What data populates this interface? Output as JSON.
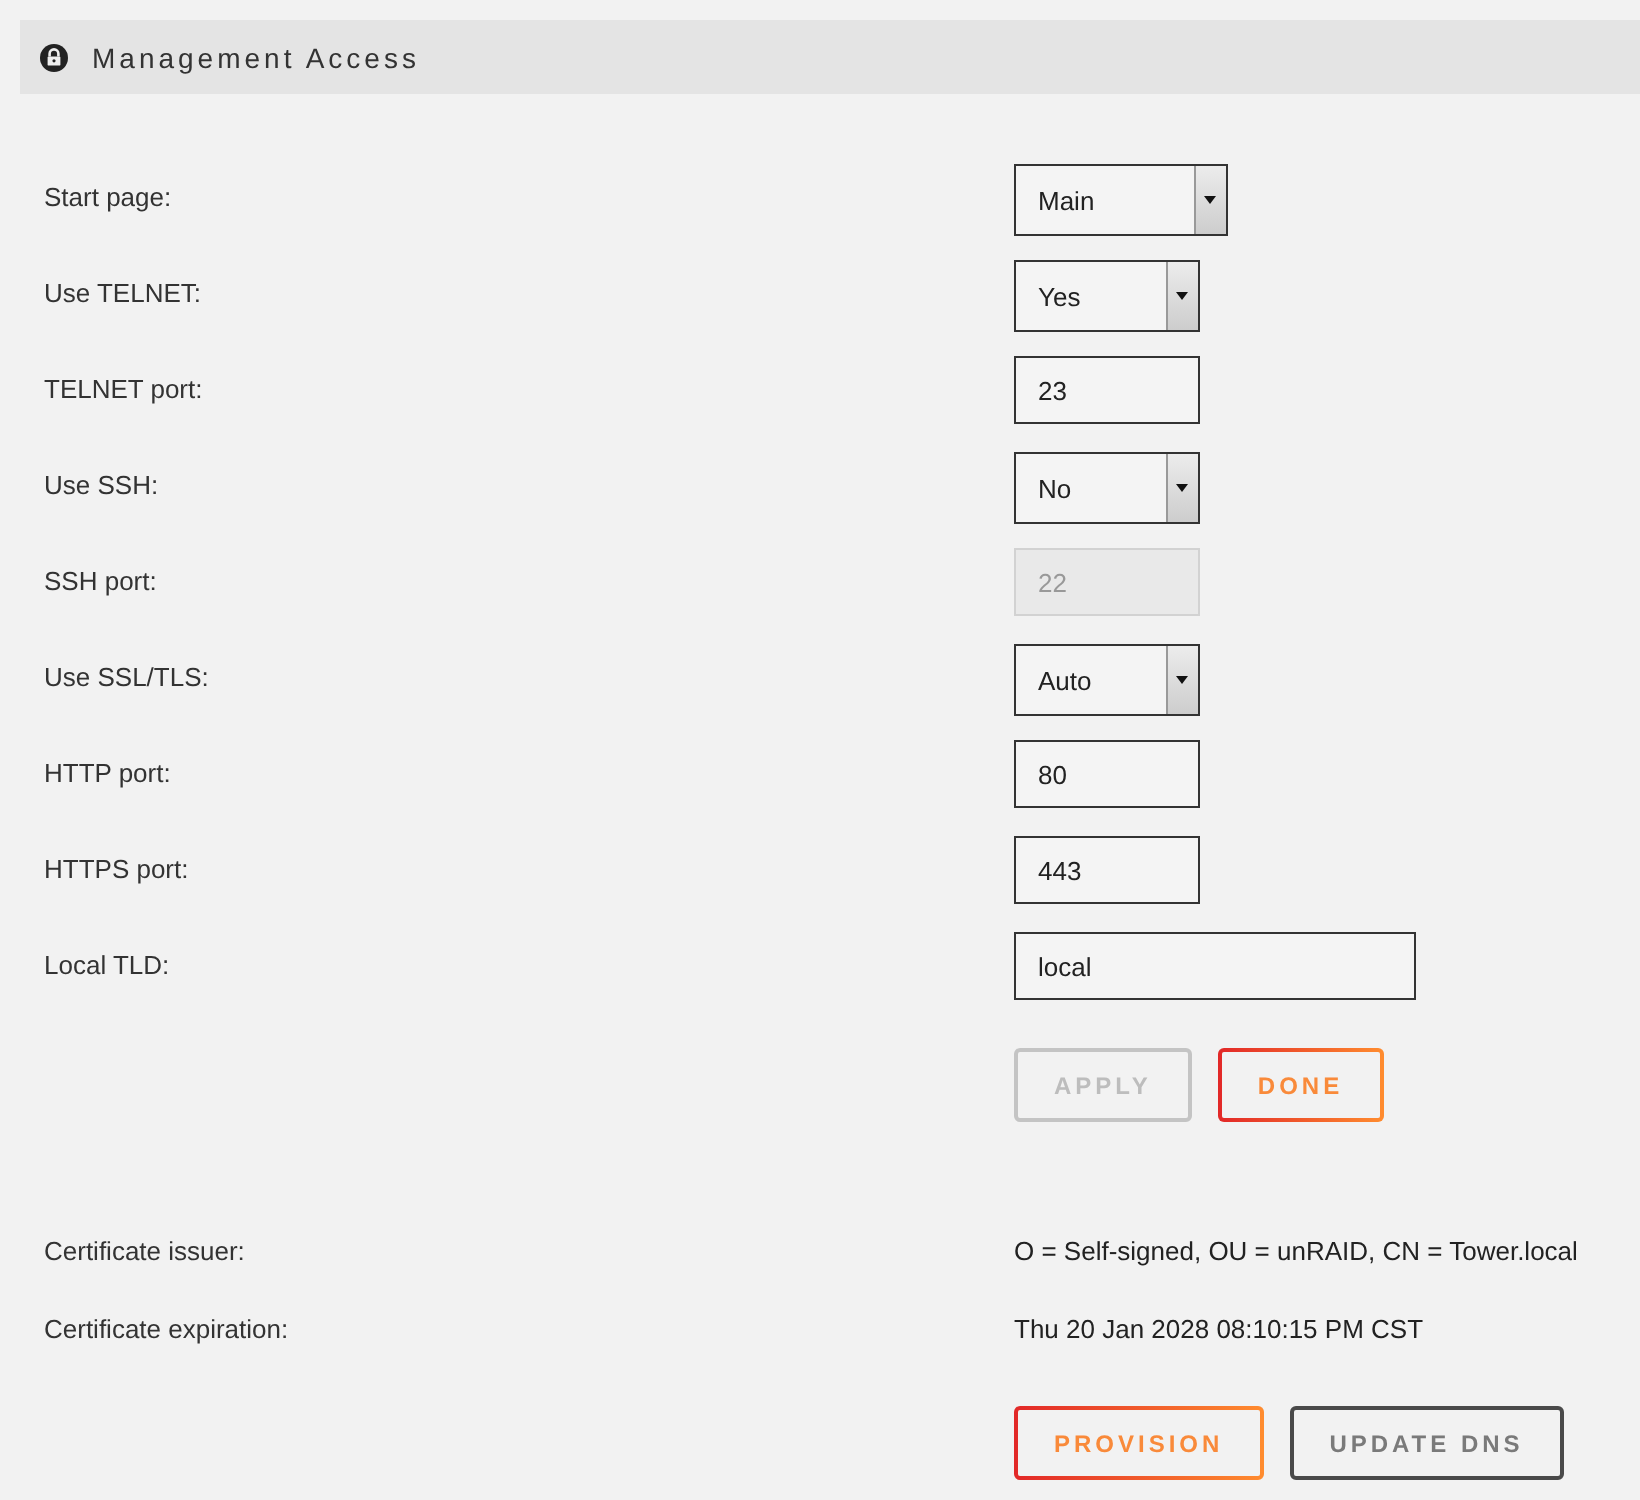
{
  "section": {
    "title": "Management Access"
  },
  "settings": [
    {
      "label": "Start page:",
      "kind": "select",
      "value": "Main",
      "disabled": false
    },
    {
      "label": "Use TELNET:",
      "kind": "select",
      "value": "Yes",
      "disabled": false
    },
    {
      "label": "TELNET port:",
      "kind": "port",
      "value": "23",
      "disabled": false
    },
    {
      "label": "Use SSH:",
      "kind": "select",
      "value": "No",
      "disabled": false
    },
    {
      "label": "SSH port:",
      "kind": "port",
      "value": "22",
      "disabled": true
    },
    {
      "label": "Use SSL/TLS:",
      "kind": "select",
      "value": "Auto",
      "disabled": false
    },
    {
      "label": "HTTP port:",
      "kind": "port",
      "value": "80",
      "disabled": false
    },
    {
      "label": "HTTPS port:",
      "kind": "port",
      "value": "443",
      "disabled": false
    },
    {
      "label": "Local TLD:",
      "kind": "text",
      "value": "local",
      "disabled": false
    }
  ],
  "form_buttons": [
    {
      "label": "APPLY",
      "kind": "accent",
      "disabled": true
    },
    {
      "label": "DONE",
      "kind": "accent",
      "disabled": false
    }
  ],
  "certificate": [
    {
      "label": "Certificate issuer:",
      "value": "O = Self-signed, OU = unRAID, CN = Tower.local"
    },
    {
      "label": "Certificate expiration:",
      "value": "Thu 20 Jan 2028 08:10:15 PM CST"
    }
  ],
  "certificate_buttons": [
    {
      "label": "PROVISION",
      "kind": "accent",
      "disabled": false
    },
    {
      "label": "UPDATE DNS",
      "kind": "plain",
      "disabled": false
    }
  ]
}
